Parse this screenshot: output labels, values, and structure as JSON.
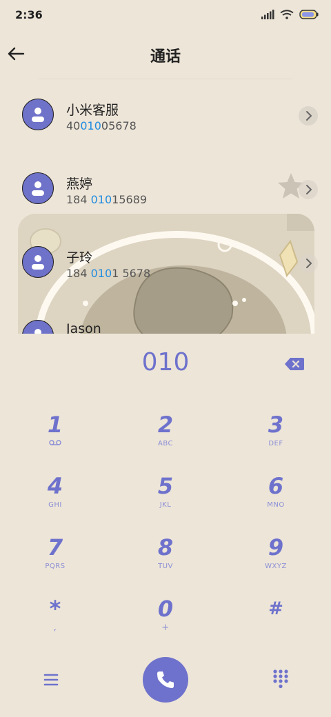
{
  "status_bar": {
    "time": "2:36"
  },
  "header": {
    "title": "通话",
    "back_icon": "arrow-left-icon"
  },
  "contacts": [
    {
      "name": "小米客服",
      "number_parts": [
        "40",
        "010",
        "05678"
      ]
    },
    {
      "name": "燕婷",
      "number_parts": [
        "184 ",
        "010",
        "15689"
      ]
    },
    {
      "name": "子玲",
      "number_parts": [
        "184 ",
        "010",
        "1 5678"
      ]
    },
    {
      "name": "Jason",
      "number_parts": [
        "",
        "",
        ""
      ]
    }
  ],
  "dialer": {
    "input": "010",
    "keys": [
      {
        "digit": "1",
        "letters": ""
      },
      {
        "digit": "2",
        "letters": "ABC"
      },
      {
        "digit": "3",
        "letters": "DEF"
      },
      {
        "digit": "4",
        "letters": "GHI"
      },
      {
        "digit": "5",
        "letters": "JKL"
      },
      {
        "digit": "6",
        "letters": "MNO"
      },
      {
        "digit": "7",
        "letters": "PQRS"
      },
      {
        "digit": "8",
        "letters": "TUV"
      },
      {
        "digit": "9",
        "letters": "WXYZ"
      },
      {
        "digit": "*",
        "letters": ","
      },
      {
        "digit": "0",
        "letters": "+"
      },
      {
        "digit": "#",
        "letters": ""
      }
    ]
  },
  "colors": {
    "accent": "#6e72cc",
    "highlight": "#1f8ce0",
    "background": "#ede5d8"
  }
}
